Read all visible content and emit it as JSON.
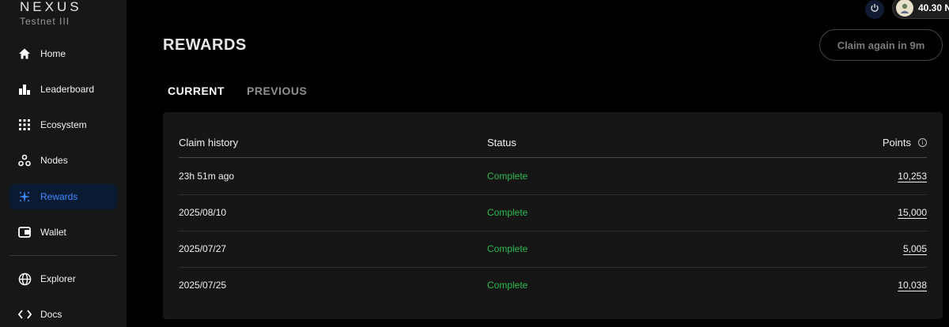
{
  "brand": {
    "name": "NEXUS",
    "subtitle": "Testnet III"
  },
  "sidebar": {
    "items": [
      {
        "label": "Home",
        "icon": "home-icon"
      },
      {
        "label": "Leaderboard",
        "icon": "bar-chart-icon"
      },
      {
        "label": "Ecosystem",
        "icon": "grid-icon"
      },
      {
        "label": "Nodes",
        "icon": "nodes-icon"
      },
      {
        "label": "Rewards",
        "icon": "rewards-icon",
        "active": true
      },
      {
        "label": "Wallet",
        "icon": "wallet-icon"
      },
      {
        "label": "Explorer",
        "icon": "globe-icon"
      },
      {
        "label": "Docs",
        "icon": "code-icon"
      }
    ]
  },
  "topbar": {
    "balance": "40.30 N"
  },
  "page": {
    "title": "REWARDS",
    "claim_button": "Claim again in 9m",
    "tabs": [
      {
        "label": "CURRENT",
        "active": true
      },
      {
        "label": "PREVIOUS"
      }
    ]
  },
  "table": {
    "headers": {
      "claim": "Claim history",
      "status": "Status",
      "points": "Points"
    },
    "rows": [
      {
        "claim": "23h 51m ago",
        "status": "Complete",
        "points": "10,253"
      },
      {
        "claim": "2025/08/10",
        "status": "Complete",
        "points": "15,000"
      },
      {
        "claim": "2025/07/27",
        "status": "Complete",
        "points": "5,005"
      },
      {
        "claim": "2025/07/25",
        "status": "Complete",
        "points": "10,038"
      }
    ]
  },
  "colors": {
    "accent": "#3d8bff",
    "status_complete": "#2fb84f",
    "active_bg": "#0b1a33"
  }
}
